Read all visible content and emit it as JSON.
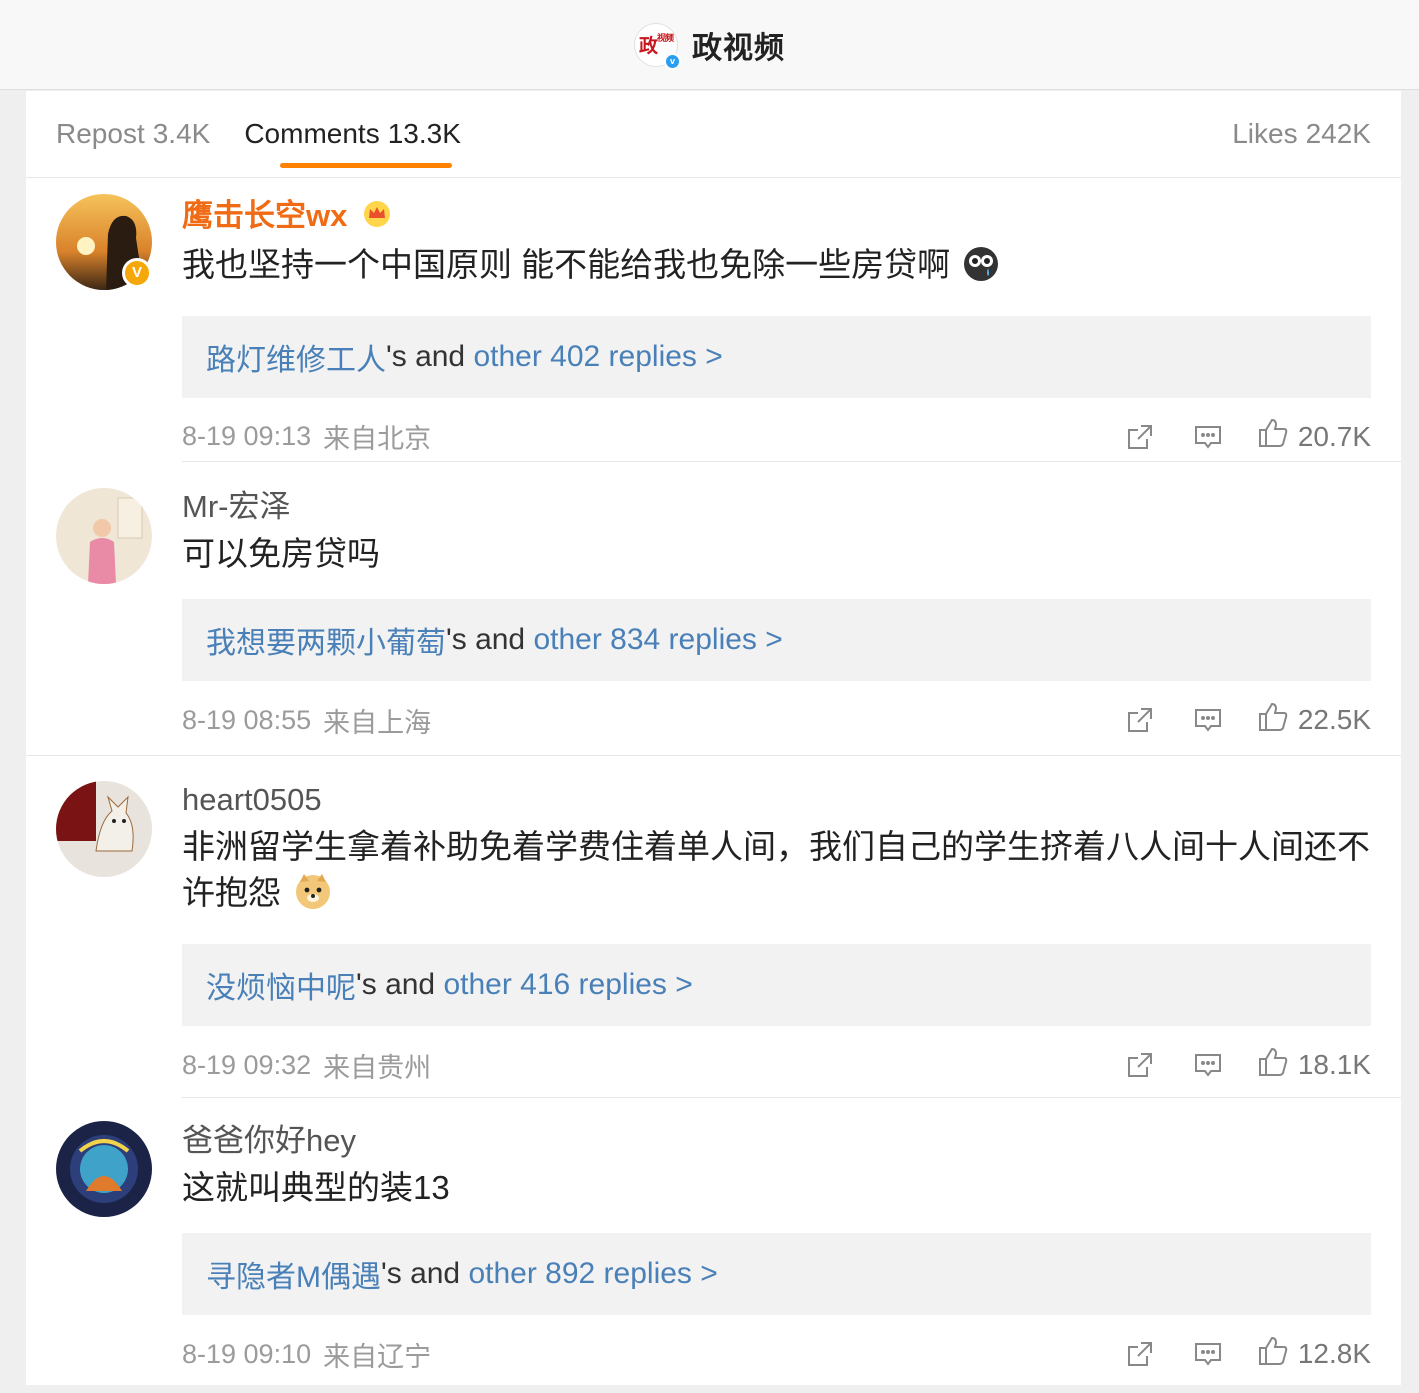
{
  "header": {
    "channel_name": "政视频",
    "logo_text": "政",
    "logo_small": "视频",
    "verified_mark": "v"
  },
  "tabs": [
    {
      "label": "Repost",
      "count": "3.4K"
    },
    {
      "label": "Comments",
      "count": "13.3K"
    },
    {
      "label": "Likes",
      "count": "242K"
    }
  ],
  "comments": [
    {
      "username": "鹰击长空wx",
      "text": "我也坚持一个中国原则 能不能给我也免除一些房贷啊",
      "reply_user": "路灯维修工人",
      "reply_mid": "'s and ",
      "reply_link": "other 402 replies >",
      "time": "8-19 09:13",
      "location": "来自北京",
      "likes": "20.7K",
      "verified_badge": "V",
      "avatar_colors": [
        "#f3b24a",
        "#3a2a1c"
      ]
    },
    {
      "username": "Mr-宏泽",
      "text": "可以免房贷吗",
      "reply_user": "我想要两颗小葡萄",
      "reply_mid": "'s and ",
      "reply_link": "other 834 replies >",
      "time": "8-19 08:55",
      "location": "来自上海",
      "likes": "22.5K",
      "avatar_colors": [
        "#efe6d6",
        "#e98aa6"
      ]
    },
    {
      "username": "heart0505",
      "text": "非洲留学生拿着补助免着学费住着单人间，我们自己的学生挤着八人间十人间还不许抱怨",
      "reply_user": "没烦恼中呢",
      "reply_mid": "'s and ",
      "reply_link": "other 416 replies >",
      "time": "8-19 09:32",
      "location": "来自贵州",
      "likes": "18.1K",
      "avatar_colors": [
        "#7a1414",
        "#e8e3dc"
      ]
    },
    {
      "username": "爸爸你好hey",
      "text": "这就叫典型的装13",
      "reply_user": "寻隐者M偶遇",
      "reply_mid": "'s and ",
      "reply_link": "other 892 replies >",
      "time": "8-19 09:10",
      "location": "来自辽宁",
      "likes": "12.8K",
      "avatar_colors": [
        "#1b2447",
        "#e07a2c"
      ]
    }
  ],
  "icons": {
    "share": "share-icon",
    "comment": "comment-icon",
    "like": "thumbs-up-icon"
  },
  "colors": {
    "accent": "#ff8200",
    "link": "#4a80b8",
    "vip_name": "#f06b13"
  }
}
